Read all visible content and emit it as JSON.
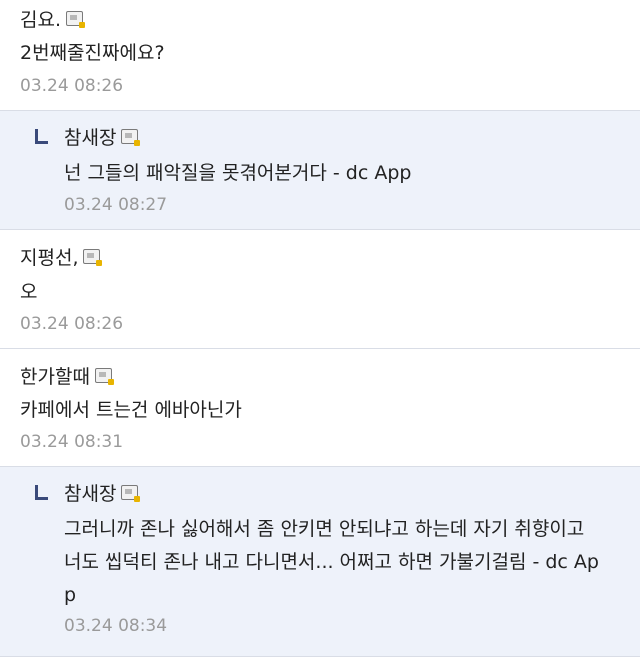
{
  "comments": [
    {
      "nick": "김요.",
      "text": "2번째줄진짜에요?",
      "date": "03.24 08:26"
    },
    {
      "nick": "참새장",
      "text": "넌 그들의 패악질을 못겪어본거다 - dc App",
      "date": "03.24 08:27",
      "reply": true
    },
    {
      "nick": "지평선,",
      "text": "오",
      "date": "03.24 08:26"
    },
    {
      "nick": "한가할때",
      "text": "카페에서 트는건 에바아닌가",
      "date": "03.24 08:31"
    },
    {
      "nick": "참새장",
      "text_lines": [
        "그러니까 존나 싫어해서 좀 안키면 안되냐고 하는데 자기 취향이고",
        "너도 씹덕티 존나 내고 다니면서... 어쩌고 하면 가불기걸림 - dc Ap",
        "p"
      ],
      "date": "03.24 08:34",
      "reply": true
    }
  ]
}
